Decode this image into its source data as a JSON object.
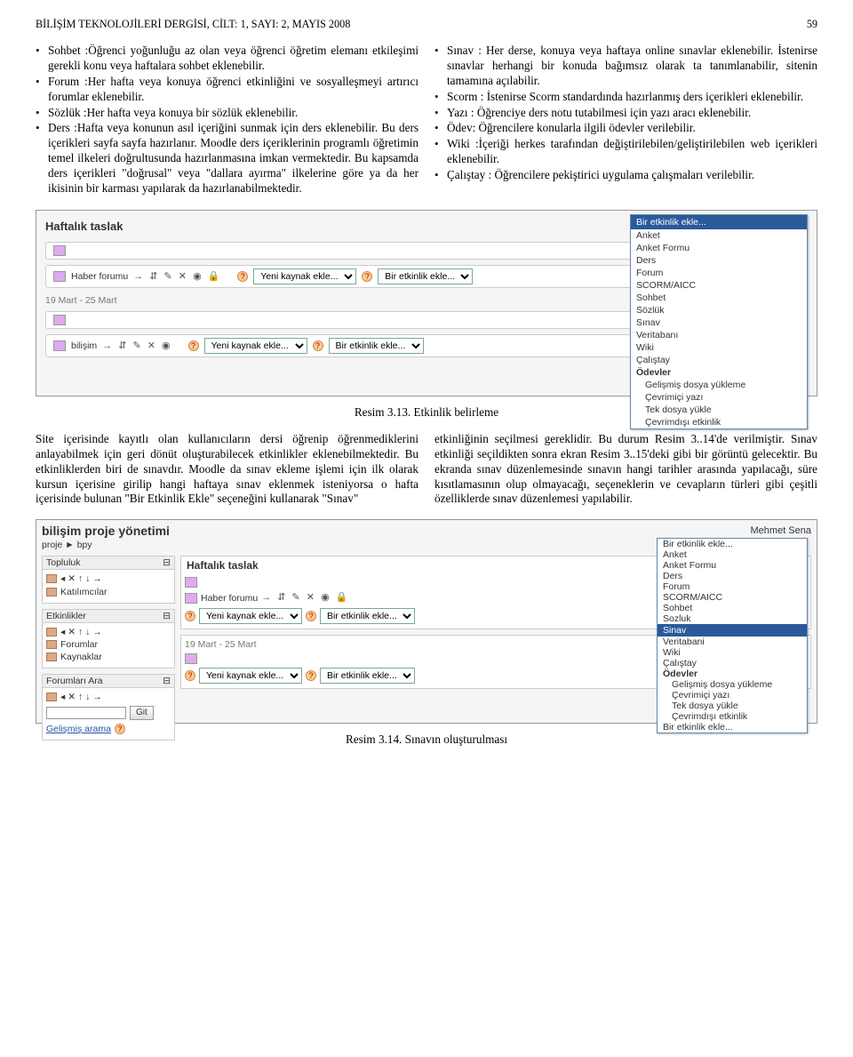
{
  "header": {
    "left": "BİLİŞİM TEKNOLOJİLERİ DERGİSİ, CİLT: 1, SAYI: 2, MAYIS 2008",
    "right": "59"
  },
  "left_col_items": [
    "Sohbet :Öğrenci yoğunluğu az olan veya öğrenci öğretim elemanı etkileşimi gerekli konu veya haftalara sohbet eklenebilir.",
    "Forum :Her hafta veya konuya öğrenci etkinliğini ve sosyalleşmeyi artırıcı forumlar eklenebilir.",
    "Sözlük :Her hafta veya konuya bir sözlük eklenebilir.",
    "Ders :Hafta veya konunun asıl içeriğini sunmak için ders eklenebilir. Bu ders içerikleri sayfa sayfa hazırlanır. Moodle ders içeriklerinin programlı öğretimin temel ilkeleri doğrultusunda hazırlanmasına imkan vermektedir. Bu kapsamda ders içerikleri \"doğrusal\" veya \"dallara ayırma\" ilkelerine göre ya da her ikisinin bir karması yapılarak da hazırlanabilmektedir."
  ],
  "right_col_items": [
    "Sınav : Her derse, konuya veya haftaya online sınavlar eklenebilir. İstenirse sınavlar herhangi bir konuda bağımsız olarak ta tanımlanabilir, sitenin tamamına açılabilir.",
    "Scorm : İstenirse Scorm standardında hazırlanmış ders içerikleri eklenebilir.",
    "Yazı : Öğrenciye ders notu tutabilmesi için yazı aracı eklenebilir.",
    "Ödev: Öğrencilere konularla ilgili ödevler verilebilir.",
    "Wiki :İçeriği herkes tarafından değiştirilebilen/geliştirilebilen web içerikleri eklenebilir.",
    "Çalıştay : Öğrencilere pekiştirici uygulama çalışmaları verilebilir."
  ],
  "fig313": {
    "title": "Haftalık taslak",
    "haber_forumu": "Haber forumu",
    "date": "19 Mart - 25 Mart",
    "bilisim": "bilişim",
    "select_kaynak": "Yeni kaynak ekle...",
    "select_etkinlik": "Bir etkinlik ekle...",
    "menu_head": "Bir etkinlik ekle...",
    "menu_items": [
      "Anket",
      "Anket Formu",
      "Ders",
      "Forum",
      "SCORM/AICC",
      "Sohbet",
      "Sözlük",
      "Sınav",
      "Veritabanı",
      "Wiki",
      "Çalıştay"
    ],
    "menu_bold": "Ödevler",
    "menu_sub": [
      "Gelişmiş dosya yükleme",
      "Çevrimiçi yazı",
      "Tek dosya yükle",
      "Çevrimdışı etkinlik"
    ]
  },
  "caption313": "Resim 3.13. Etkinlik belirleme",
  "mid_left": "Site içerisinde kayıtlı olan kullanıcıların dersi öğrenip öğrenmediklerini anlayabilmek için geri dönüt oluşturabilecek etkinlikler eklenebilmektedir. Bu etkinliklerden biri de sınavdır. Moodle da sınav ekleme işlemi için ilk olarak kursun içerisine girilip hangi haftaya sınav eklenmek isteniyorsa o hafta içerisinde bulunan \"Bir Etkinlik Ekle\" seçeneğini kullanarak \"Sınav\"",
  "mid_right": "etkinliğinin seçilmesi gereklidir. Bu durum Resim 3..14'de verilmiştir. Sınav etkinliği seçildikten sonra ekran Resim 3..15'deki gibi bir görüntü gelecektir. Bu ekranda sınav düzenlemesinde sınavın hangi tarihler arasında yapılacağı, süre kısıtlamasının olup olmayacağı, seçeneklerin ve cevapların türleri gibi çeşitli özelliklerde sınav düzenlemesi yapılabilir.",
  "fig314": {
    "title": "bilişim proje yönetimi",
    "crumb": "proje ► bpy",
    "user": "Mehmet Sena",
    "sidebar": {
      "topluluk": {
        "h": "Topluluk",
        "item": "Katılımcılar"
      },
      "etkinlikler": {
        "h": "Etkinlikler",
        "items": [
          "Forumlar",
          "Kaynaklar"
        ]
      },
      "ara": {
        "h": "Forumları Ara",
        "btn": "Git",
        "link": "Gelişmiş arama"
      }
    },
    "main": {
      "h": "Haftalık taslak",
      "haber": "Haber forumu",
      "date": "19 Mart - 25 Mart",
      "select_kaynak": "Yeni kaynak ekle...",
      "select_etkinlik": "Bir etkinlik ekle..."
    },
    "menu_items_top": [
      "Bir etkinlik ekle...",
      "Anket",
      "Anket Formu",
      "Ders",
      "Forum",
      "SCORM/AICC",
      "Sohbet",
      "Sozluk"
    ],
    "menu_hl": "Sinav",
    "menu_items_bot": [
      "Veritabani",
      "Wiki",
      "Çalıştay"
    ],
    "menu_bold": "Ödevler",
    "menu_sub": [
      "Gelişmiş dosya yükleme",
      "Çevrimiçi yazı",
      "Tek dosya yükle",
      "Çevrimdışı etkinlik"
    ],
    "menu_last": "Bir etkinlik ekle..."
  },
  "caption314": "Resim 3.14. Sınavın oluşturulması"
}
